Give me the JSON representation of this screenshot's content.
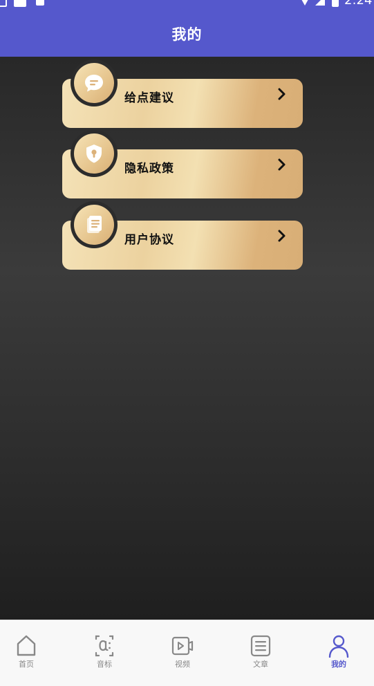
{
  "status_bar": {
    "time": "2:24"
  },
  "header": {
    "title": "我的"
  },
  "menu": {
    "items": [
      {
        "label": "给点建议",
        "icon": "chat-bubble-icon"
      },
      {
        "label": "隐私政策",
        "icon": "shield-lock-icon"
      },
      {
        "label": "用户协议",
        "icon": "document-icon"
      }
    ]
  },
  "bottom_nav": {
    "items": [
      {
        "label": "首页",
        "icon": "home-icon",
        "active": false
      },
      {
        "label": "音标",
        "icon": "phonetic-icon",
        "active": false
      },
      {
        "label": "视频",
        "icon": "video-icon",
        "active": false
      },
      {
        "label": "文章",
        "icon": "article-icon",
        "active": false
      },
      {
        "label": "我的",
        "icon": "profile-icon",
        "active": true
      }
    ]
  },
  "colors": {
    "primary": "#5558cc",
    "gold_light": "#f4e2b7",
    "gold_dark": "#d8ae76",
    "nav_inactive": "#888888"
  }
}
